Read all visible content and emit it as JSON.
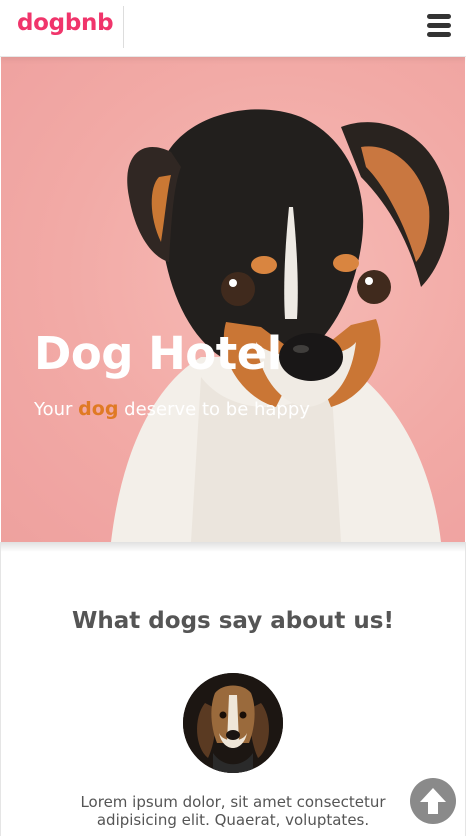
{
  "navbar": {
    "brand": "dogbnb",
    "menu_icon": "hamburger-menu-icon"
  },
  "hero": {
    "title": "Dog Hotel",
    "subtitle_before": "Your",
    "subtitle_accent": "dog",
    "subtitle_after": "deserve to be happy",
    "accent_color": "#e07a24",
    "background_color": "#f2a8a4"
  },
  "testimonials": {
    "heading": "What dogs say about us!",
    "quote": "Lorem ipsum dolor, sit amet consectetur adipisicing elit. Quaerat, voluptates."
  },
  "scroll_top": {
    "icon": "arrow-up-icon"
  },
  "colors": {
    "brand": "#f0356b",
    "heading_text": "#555555"
  }
}
